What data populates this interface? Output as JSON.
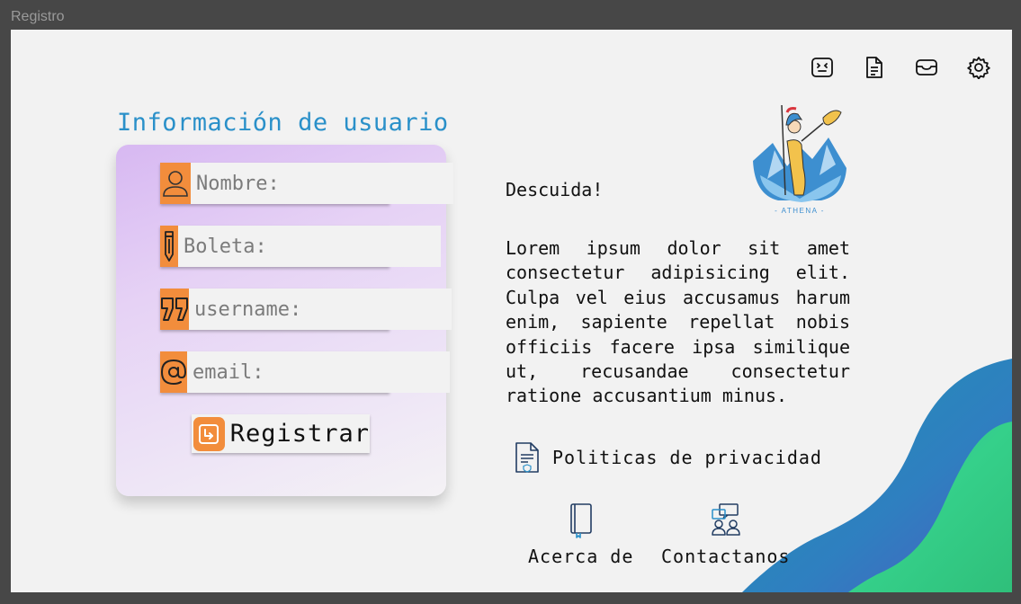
{
  "window": {
    "title": "Registro"
  },
  "toolbar": {
    "icons": [
      "robot-face-icon",
      "document-icon",
      "inbox-icon",
      "gear-icon"
    ]
  },
  "form": {
    "title": "Información de usuario",
    "fields": [
      {
        "icon": "user-icon",
        "placeholder": "Nombre:",
        "value": ""
      },
      {
        "icon": "pencil-icon",
        "placeholder": "Boleta:",
        "value": ""
      },
      {
        "icon": "quote-icon",
        "placeholder": "username:",
        "value": ""
      },
      {
        "icon": "at-sign-icon",
        "placeholder": "email:",
        "value": ""
      }
    ],
    "submit_label": "Registrar"
  },
  "brand": {
    "logo_text": "- ATHENA -"
  },
  "info": {
    "greeting": "Descuida!",
    "body": "Lorem ipsum dolor sit amet consectetur adipisicing elit. Culpa vel eius accusamus harum enim, sapiente repellat nobis officiis facere ipsa similique ut, recusandae consectetur ratione accusantium minus."
  },
  "links": {
    "privacy": "Politicas de privacidad",
    "about": "Acerca de",
    "contact": "Contactanos"
  },
  "colors": {
    "accent_orange": "#f28d3c",
    "title_blue": "#2a90c9",
    "card_gradient_start": "#d7b8f2",
    "wave_teal": "#1f93b4",
    "wave_green": "#35d08a"
  }
}
